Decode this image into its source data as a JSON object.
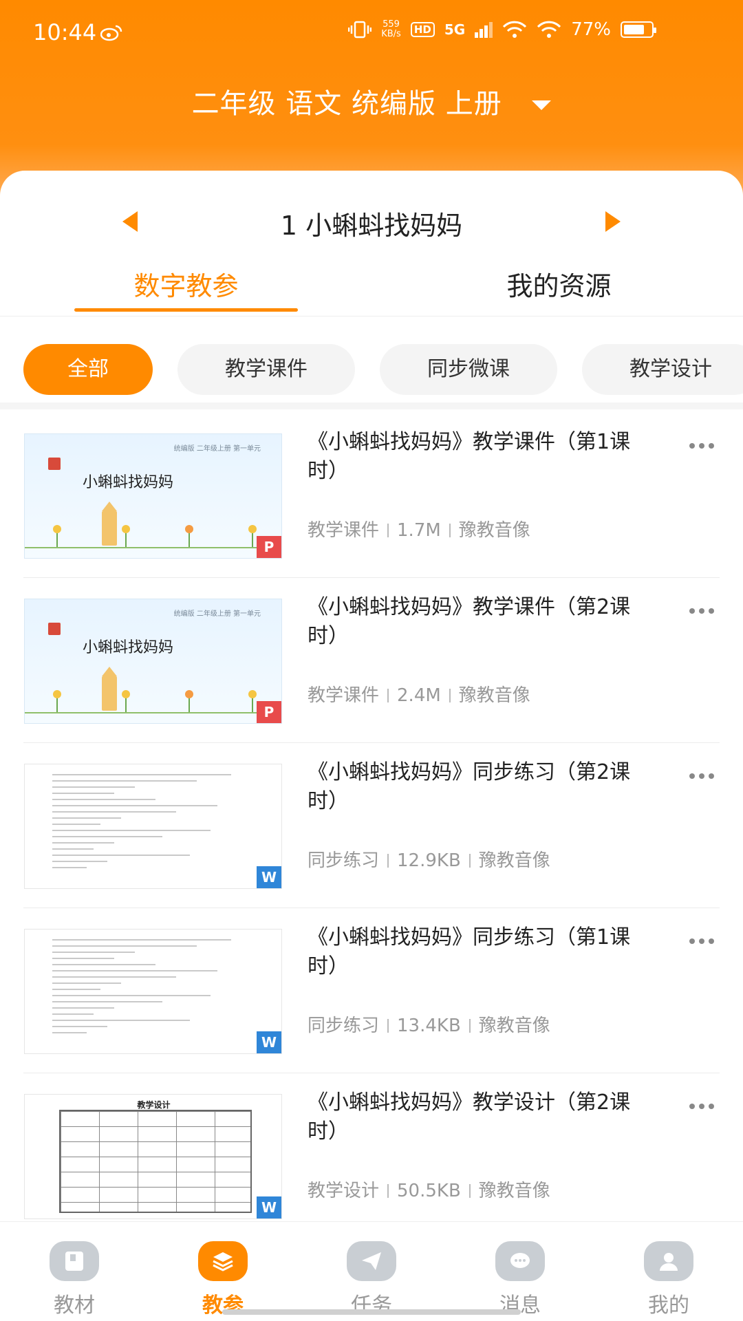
{
  "status_bar": {
    "time": "10:44",
    "net_speed_value": "559",
    "net_speed_unit": "KB/s",
    "hd": "HD",
    "network": "5G",
    "battery": "77%",
    "battery_level": 0.77
  },
  "header": {
    "book_selector": "二年级 语文 统编版 上册"
  },
  "lesson": {
    "title": "1 小蝌蚪找妈妈"
  },
  "tabs": [
    {
      "label": "数字教参",
      "active": true
    },
    {
      "label": "我的资源",
      "active": false
    }
  ],
  "filters": [
    {
      "label": "全部",
      "active": true
    },
    {
      "label": "教学课件",
      "active": false
    },
    {
      "label": "同步微课",
      "active": false
    },
    {
      "label": "教学设计",
      "active": false
    }
  ],
  "resources": [
    {
      "title": "《小蝌蚪找妈妈》教学课件（第1课时）",
      "type": "教学课件",
      "size": "1.7M",
      "publisher": "豫教音像",
      "badge": "P",
      "thumb_kind": "ppt",
      "thumb_header": "统编版 二年级上册 第一单元",
      "thumb_title": "小蝌蚪找妈妈"
    },
    {
      "title": "《小蝌蚪找妈妈》教学课件（第2课时）",
      "type": "教学课件",
      "size": "2.4M",
      "publisher": "豫教音像",
      "badge": "P",
      "thumb_kind": "ppt",
      "thumb_header": "统编版 二年级上册 第一单元",
      "thumb_title": "小蝌蚪找妈妈"
    },
    {
      "title": "《小蝌蚪找妈妈》同步练习（第2课时）",
      "type": "同步练习",
      "size": "12.9KB",
      "publisher": "豫教音像",
      "badge": "W",
      "thumb_kind": "doc"
    },
    {
      "title": "《小蝌蚪找妈妈》同步练习（第1课时）",
      "type": "同步练习",
      "size": "13.4KB",
      "publisher": "豫教音像",
      "badge": "W",
      "thumb_kind": "doc"
    },
    {
      "title": "《小蝌蚪找妈妈》教学设计（第2课时）",
      "type": "教学设计",
      "size": "50.5KB",
      "publisher": "豫教音像",
      "badge": "W",
      "thumb_kind": "table",
      "thumb_title": "教学设计"
    }
  ],
  "bottom_nav": [
    {
      "label": "教材",
      "icon": "book-icon",
      "active": false
    },
    {
      "label": "教参",
      "icon": "layers-icon",
      "active": true
    },
    {
      "label": "任务",
      "icon": "paper-plane-icon",
      "active": false
    },
    {
      "label": "消息",
      "icon": "chat-bubble-icon",
      "active": false
    },
    {
      "label": "我的",
      "icon": "user-icon",
      "active": false
    }
  ],
  "colors": {
    "accent": "#ff8a00",
    "badge_ppt": "#e84b4b",
    "badge_word": "#2f86d8"
  }
}
